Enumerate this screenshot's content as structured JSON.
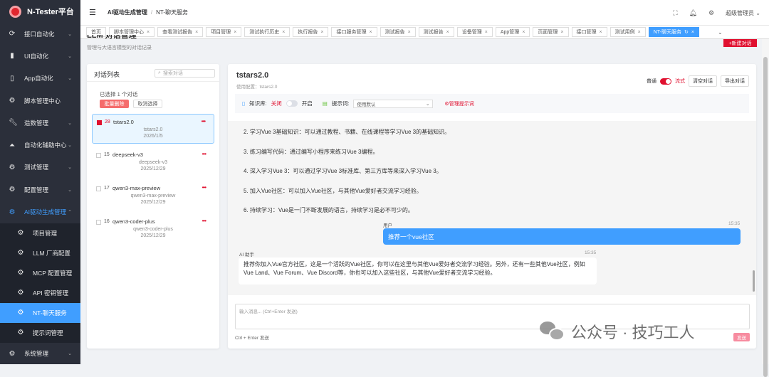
{
  "app": {
    "name": "N-Tester平台"
  },
  "sidebar": {
    "items": [
      {
        "label": "接口自动化",
        "icon": "refresh-icon",
        "expandable": true
      },
      {
        "label": "UI自动化",
        "icon": "book-icon",
        "expandable": true
      },
      {
        "label": "App自动化",
        "icon": "phone-icon",
        "expandable": true
      },
      {
        "label": "脚本管理中心",
        "icon": "gear-icon",
        "expandable": false
      },
      {
        "label": "造数管理",
        "icon": "wrench-icon",
        "expandable": true
      },
      {
        "label": "自动化辅助中心",
        "icon": "helper-icon",
        "expandable": true
      },
      {
        "label": "测试管理",
        "icon": "gear-icon",
        "expandable": true
      },
      {
        "label": "配置管理",
        "icon": "gear-icon",
        "expandable": true
      },
      {
        "label": "AI驱动生成管理",
        "icon": "gear-icon",
        "expandable": true
      }
    ],
    "subitems": [
      {
        "label": "项目管理"
      },
      {
        "label": "LLM 厂商配置"
      },
      {
        "label": "MCP 配置管理"
      },
      {
        "label": "API 密钥管理"
      },
      {
        "label": "NT-聊天服务"
      },
      {
        "label": "提示词管理"
      }
    ],
    "last": {
      "label": "系统管理"
    }
  },
  "header": {
    "breadcrumb": [
      "AI驱动生成管理",
      "NT-聊天服务"
    ],
    "user": "超级管理员"
  },
  "tabs": [
    "首页",
    "脚本管理中心",
    "查看测试报告",
    "项目管理",
    "测试执行历史",
    "执行报告",
    "接口服务管理",
    "测试报告",
    "测试报告",
    "设备管理",
    "App管理",
    "页面管理",
    "接口管理",
    "测试用例",
    "NT-聊天服务"
  ],
  "page": {
    "title": "LLM 对话管理",
    "subtitle": "管理与大语言模型的对话记录",
    "new_button": "+新建对话"
  },
  "list": {
    "title": "对话列表",
    "search_placeholder": "搜索对话",
    "selected_info": "已选择 1 个对话",
    "batch_delete": "批量删除",
    "cancel_select": "取消选择",
    "items": [
      {
        "count": "28",
        "name": "tstars2.0",
        "model": "tstars2.0",
        "date": "2026/1/5",
        "selected": true
      },
      {
        "count": "15",
        "name": "deepseek-v3",
        "model": "deepseek-v3",
        "date": "2025/12/29",
        "selected": false
      },
      {
        "count": "17",
        "name": "qwen3-max-preview",
        "model": "qwen3-max-preview",
        "date": "2025/12/29",
        "selected": false
      },
      {
        "count": "16",
        "name": "qwen3-coder-plus",
        "model": "qwen3-coder-plus",
        "date": "2025/12/29",
        "selected": false
      }
    ]
  },
  "chat": {
    "title": "tstars2.0",
    "config": "使用配置：tstars2.0",
    "mode_normal": "普通",
    "mode_stream": "流式",
    "clear": "清空对话",
    "export": "导出对话",
    "kb_label": "知识库:",
    "kb_off": "关闭",
    "kb_on": "开启",
    "prompt_label": "提示词:",
    "prompt_value": "使用默认",
    "manage_prompts": "⚙管理提示词",
    "old_lines": [
      "2. 学习Vue 3基础知识：可以通过教程、书籍、在线课程等学习Vue 3的基础知识。",
      "3. 练习编写代码：通过编写小程序来练习Vue 3编程。",
      "4. 深入学习Vue 3：可以通过学习Vue 3标准库、第三方库等来深入学习Vue 3。",
      "5. 加入Vue社区：可以加入Vue社区，与其他Vue爱好者交流学习经验。",
      "6. 持续学习：Vue是一门不断发展的语言，持续学习是必不可少的。"
    ],
    "user_role": "用户",
    "user_time": "15:35",
    "user_msg": "推荐一个vue社区",
    "ai_role": "AI 助手",
    "ai_time": "15:35",
    "ai_msg": "推荐你加入Vue官方社区，这是一个活跃的Vue社区，你可以在这里与其他Vue爱好者交流学习经验。另外，还有一些其他Vue社区，例如Vue Land、Vue Forum、Vue Discord等，你也可以加入这些社区，与其他Vue爱好者交流学习经验。",
    "input_placeholder": "输入消息... (Ctrl+Enter 发送)",
    "hint": "Ctrl + Enter 发送",
    "send": "发送"
  },
  "watermark": "公众号 · 技巧工人"
}
